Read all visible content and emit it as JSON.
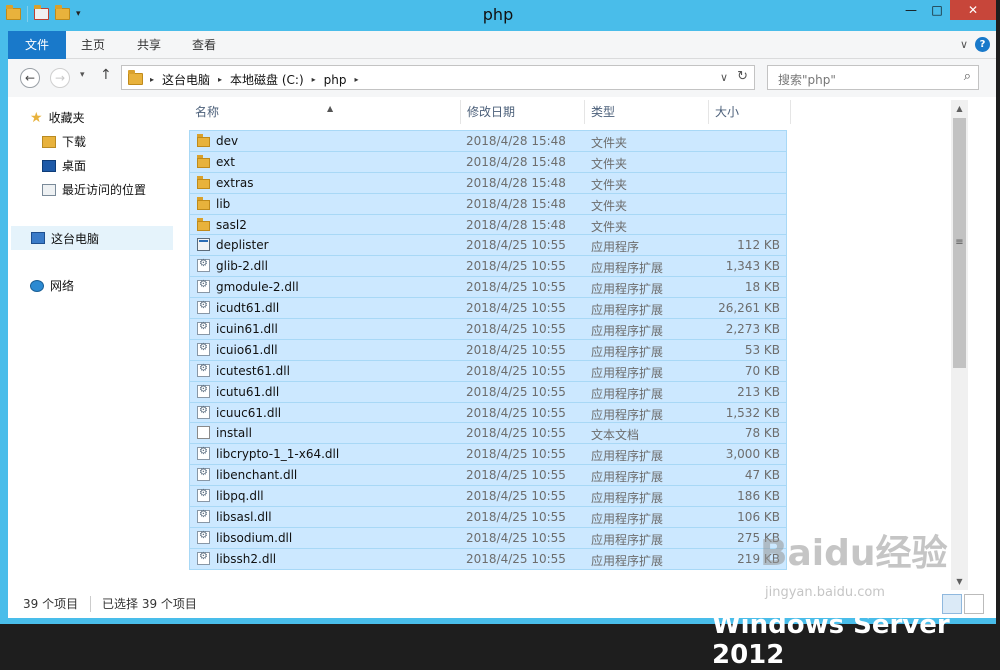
{
  "window": {
    "title": "php",
    "controls": {
      "minimize": "—",
      "maximize": "□",
      "close": "✕"
    },
    "qat_dropdown": "▾"
  },
  "ribbon": {
    "tabs": [
      "文件",
      "主页",
      "共享",
      "查看"
    ],
    "expand": "∨",
    "help": "?"
  },
  "address": {
    "back": "←",
    "forward": "→",
    "recent": "▾",
    "up": "↑",
    "crumbs": [
      "这台电脑",
      "本地磁盘 (C:)",
      "php"
    ],
    "crumb_arrow": "▸",
    "dropdown": "∨",
    "refresh": "↻"
  },
  "search": {
    "placeholder": "搜索\"php\"",
    "icon": "⌕"
  },
  "nav": {
    "favorites_label": "收藏夹",
    "favorites": [
      "下载",
      "桌面",
      "最近访问的位置"
    ],
    "thispc_label": "这台电脑",
    "network_label": "网络"
  },
  "columns": {
    "name": "名称",
    "date": "修改日期",
    "type": "类型",
    "size": "大小",
    "sort_glyph": "▲"
  },
  "files": [
    {
      "name": "dev",
      "date": "2018/4/28 15:48",
      "type": "文件夹",
      "size": "",
      "icon": "folder"
    },
    {
      "name": "ext",
      "date": "2018/4/28 15:48",
      "type": "文件夹",
      "size": "",
      "icon": "folder"
    },
    {
      "name": "extras",
      "date": "2018/4/28 15:48",
      "type": "文件夹",
      "size": "",
      "icon": "folder"
    },
    {
      "name": "lib",
      "date": "2018/4/28 15:48",
      "type": "文件夹",
      "size": "",
      "icon": "folder"
    },
    {
      "name": "sasl2",
      "date": "2018/4/28 15:48",
      "type": "文件夹",
      "size": "",
      "icon": "folder"
    },
    {
      "name": "deplister",
      "date": "2018/4/25 10:55",
      "type": "应用程序",
      "size": "112 KB",
      "icon": "exe"
    },
    {
      "name": "glib-2.dll",
      "date": "2018/4/25 10:55",
      "type": "应用程序扩展",
      "size": "1,343 KB",
      "icon": "dll"
    },
    {
      "name": "gmodule-2.dll",
      "date": "2018/4/25 10:55",
      "type": "应用程序扩展",
      "size": "18 KB",
      "icon": "dll"
    },
    {
      "name": "icudt61.dll",
      "date": "2018/4/25 10:55",
      "type": "应用程序扩展",
      "size": "26,261 KB",
      "icon": "dll"
    },
    {
      "name": "icuin61.dll",
      "date": "2018/4/25 10:55",
      "type": "应用程序扩展",
      "size": "2,273 KB",
      "icon": "dll"
    },
    {
      "name": "icuio61.dll",
      "date": "2018/4/25 10:55",
      "type": "应用程序扩展",
      "size": "53 KB",
      "icon": "dll"
    },
    {
      "name": "icutest61.dll",
      "date": "2018/4/25 10:55",
      "type": "应用程序扩展",
      "size": "70 KB",
      "icon": "dll"
    },
    {
      "name": "icutu61.dll",
      "date": "2018/4/25 10:55",
      "type": "应用程序扩展",
      "size": "213 KB",
      "icon": "dll"
    },
    {
      "name": "icuuc61.dll",
      "date": "2018/4/25 10:55",
      "type": "应用程序扩展",
      "size": "1,532 KB",
      "icon": "dll"
    },
    {
      "name": "install",
      "date": "2018/4/25 10:55",
      "type": "文本文档",
      "size": "78 KB",
      "icon": "txt"
    },
    {
      "name": "libcrypto-1_1-x64.dll",
      "date": "2018/4/25 10:55",
      "type": "应用程序扩展",
      "size": "3,000 KB",
      "icon": "dll"
    },
    {
      "name": "libenchant.dll",
      "date": "2018/4/25 10:55",
      "type": "应用程序扩展",
      "size": "47 KB",
      "icon": "dll"
    },
    {
      "name": "libpq.dll",
      "date": "2018/4/25 10:55",
      "type": "应用程序扩展",
      "size": "186 KB",
      "icon": "dll"
    },
    {
      "name": "libsasl.dll",
      "date": "2018/4/25 10:55",
      "type": "应用程序扩展",
      "size": "106 KB",
      "icon": "dll"
    },
    {
      "name": "libsodium.dll",
      "date": "2018/4/25 10:55",
      "type": "应用程序扩展",
      "size": "275 KB",
      "icon": "dll"
    },
    {
      "name": "libssh2.dll",
      "date": "2018/4/25 10:55",
      "type": "应用程序扩展",
      "size": "219 KB",
      "icon": "dll"
    }
  ],
  "scrollbar": {
    "up": "▲",
    "down": "▼",
    "grip": "≡"
  },
  "status": {
    "count": "39 个项目",
    "selected": "已选择 39 个项目"
  },
  "overlay": {
    "watermark": "Baidu经验",
    "watermark_sub": "jingyan.baidu.com",
    "desktop_text": "Windows Server 2012"
  },
  "colors": {
    "titlebar": "#49bdea",
    "file_tab": "#1979ca",
    "selection": "#cce8ff",
    "selection_border": "#a8d8f6",
    "close": "#c7463a"
  }
}
